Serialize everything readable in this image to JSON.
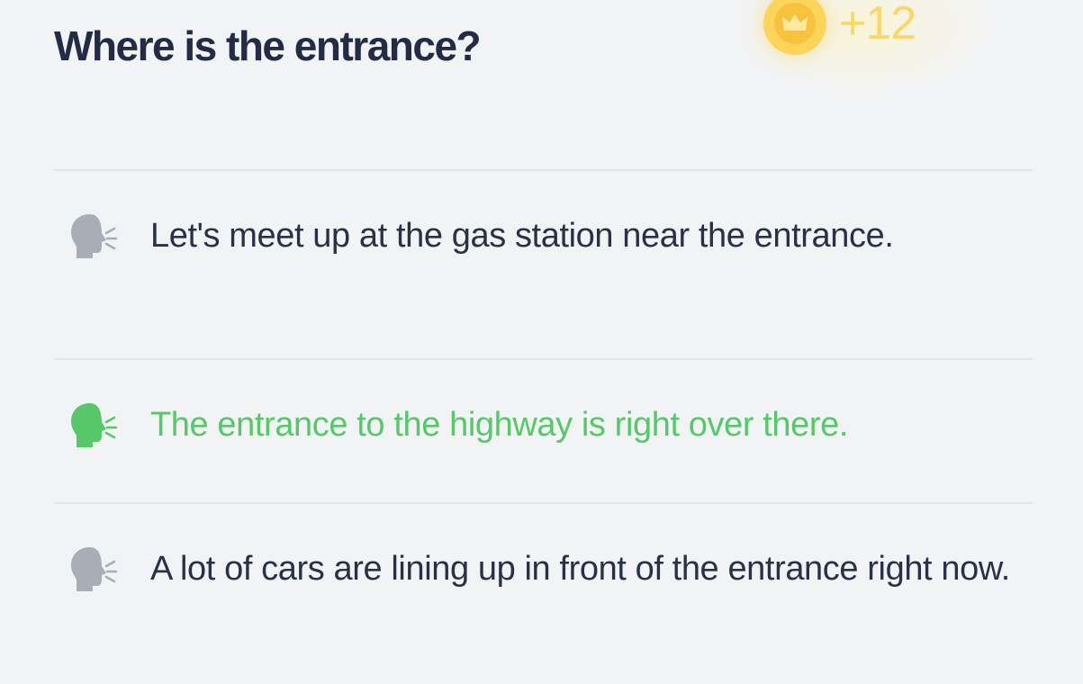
{
  "question": {
    "text": "Where is the entrance?"
  },
  "reward": {
    "amount": "+12",
    "icon": "crown-coin-icon",
    "coin_color": "#fbd45c",
    "text_color": "#f9d76c"
  },
  "options": [
    {
      "text": "Let's meet up at the gas station near the entrance.",
      "icon": "speaking-head-icon",
      "state": "default",
      "color": "#2a3147"
    },
    {
      "text": "The entrance to the highway is right over there.",
      "icon": "speaking-head-icon",
      "state": "selected",
      "color": "#58c76a"
    },
    {
      "text": "A lot of cars are lining up in front of the entrance right now.",
      "icon": "speaking-head-icon",
      "state": "default",
      "color": "#2a3147"
    }
  ],
  "colors": {
    "background": "#f2f3f5",
    "question_text": "#232b45",
    "icon_default": "#a9adb6",
    "icon_selected": "#58c76a",
    "divider": "#e3e5ea"
  }
}
